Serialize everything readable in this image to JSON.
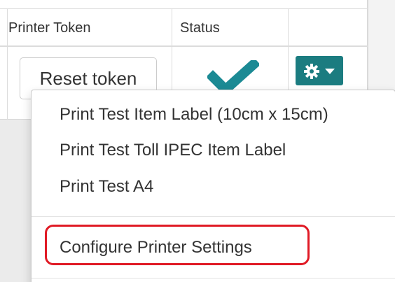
{
  "table": {
    "headers": {
      "printer_token": "Printer Token",
      "status": "Status",
      "actions": ""
    },
    "row": {
      "reset_label": "Reset token",
      "status_icon": "checkmark-icon",
      "status_color": "#1b8a94"
    }
  },
  "action_button": {
    "icon": "gear-icon",
    "caret": "caret-down-icon",
    "color": "#1b7c80"
  },
  "dropdown": {
    "items": [
      {
        "label": "Print Test Item Label (10cm x 15cm)"
      },
      {
        "label": "Print Test Toll IPEC Item Label"
      },
      {
        "label": "Print Test A4"
      },
      {
        "label": "Configure Printer Settings"
      }
    ]
  },
  "annotation": {
    "highlight_color": "#e01a25"
  }
}
